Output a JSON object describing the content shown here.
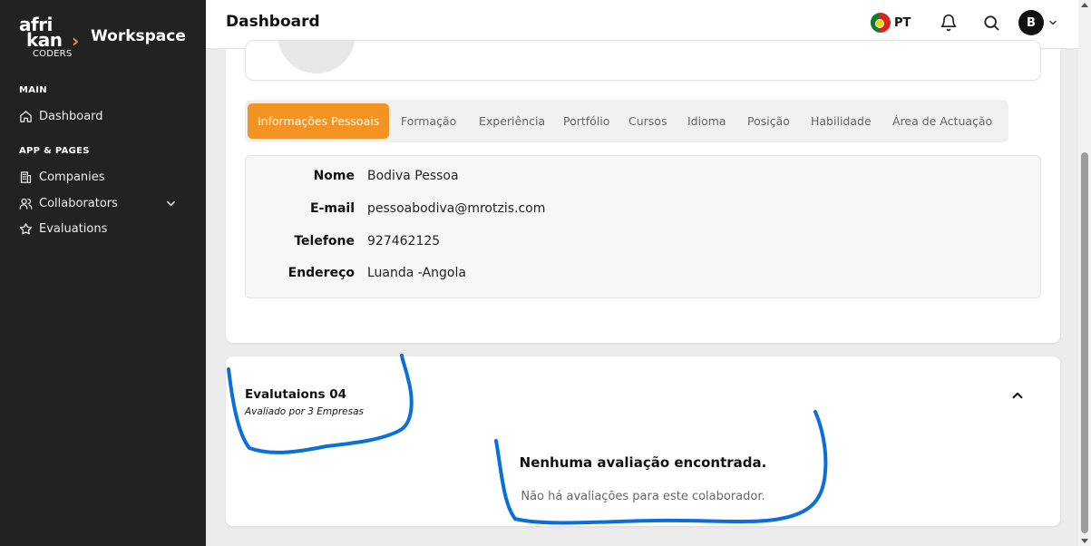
{
  "sidebar": {
    "logo": {
      "line1": "afri",
      "line2": "kan",
      "arrow": "›",
      "sub": "CODERS",
      "workspace": "Workspace"
    },
    "sections": [
      {
        "label": "MAIN"
      },
      {
        "label": "APP & PAGES"
      }
    ],
    "items": [
      {
        "label": "Dashboard",
        "icon": "home-icon"
      },
      {
        "label": "Companies",
        "icon": "building-icon"
      },
      {
        "label": "Collaborators",
        "icon": "users-icon"
      },
      {
        "label": "Evaluations",
        "icon": "star-icon"
      }
    ]
  },
  "header": {
    "title": "Dashboard",
    "language": "PT",
    "avatar_letter": "B"
  },
  "tabs": [
    {
      "label": "Informações Pessoais",
      "active": true
    },
    {
      "label": "Formação"
    },
    {
      "label": "Experiência"
    },
    {
      "label": "Portfólio"
    },
    {
      "label": "Cursos"
    },
    {
      "label": "Idioma"
    },
    {
      "label": "Posição"
    },
    {
      "label": "Habilidade"
    },
    {
      "label": "Área de Actuação"
    }
  ],
  "personal_info": [
    {
      "label": "Nome",
      "value": "Bodiva Pessoa"
    },
    {
      "label": "E-mail",
      "value": "pessoabodiva@mrotzis.com"
    },
    {
      "label": "Telefone",
      "value": "927462125"
    },
    {
      "label": "Endereço",
      "value": "Luanda -Angola"
    }
  ],
  "evaluations": {
    "title": "Evalutaions",
    "count": "04",
    "subtitle": "Avaliado por 3 Empresas",
    "empty_title": "Nenhuma avaliação encontrada.",
    "empty_message": "Não há avaliações para este colaborador."
  },
  "colors": {
    "accent": "#f39323",
    "sidebar_bg": "#222222",
    "annotation": "#0a6fd8"
  }
}
